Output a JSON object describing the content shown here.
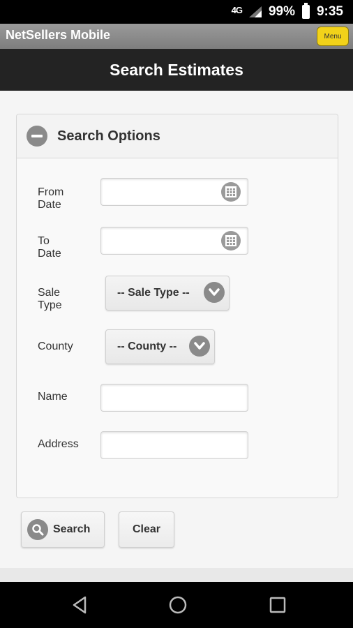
{
  "status_bar": {
    "network": "4G",
    "battery": "99%",
    "time": "9:35"
  },
  "app": {
    "title": "NetSellers Mobile",
    "menu_label": "Menu"
  },
  "header": {
    "title": "Search Estimates"
  },
  "panel": {
    "title": "Search Options",
    "fields": {
      "from_date": {
        "label": "From Date",
        "value": ""
      },
      "to_date": {
        "label": "To Date",
        "value": ""
      },
      "sale_type": {
        "label": "Sale Type",
        "selected": "-- Sale Type --"
      },
      "county": {
        "label": "County",
        "selected": "-- County --"
      },
      "name": {
        "label": "Name",
        "value": ""
      },
      "address": {
        "label": "Address",
        "value": ""
      }
    }
  },
  "buttons": {
    "search": "Search",
    "clear": "Clear"
  },
  "icons": {
    "collapse": "minus-circle-icon",
    "calendar": "calendar-icon",
    "dropdown": "chevron-down-icon",
    "search": "search-icon",
    "nav_back": "back-icon",
    "nav_home": "home-icon",
    "nav_recents": "recents-icon"
  },
  "colors": {
    "menu_button": "#f2d21a",
    "header_bg": "#232323",
    "icon_gray": "#8a8a8a"
  }
}
